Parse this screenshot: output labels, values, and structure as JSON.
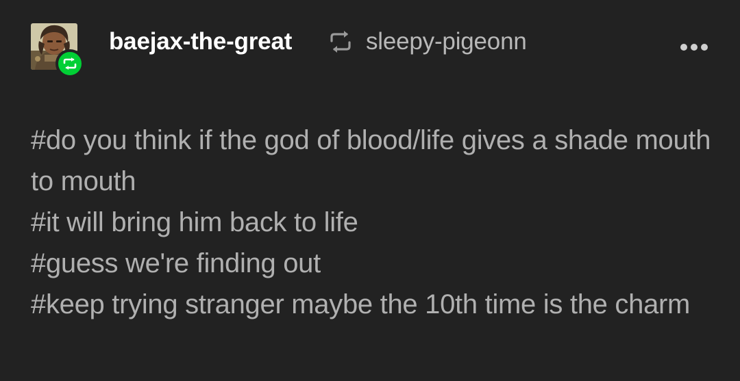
{
  "post": {
    "blog_name": "baejax-the-great",
    "reblogged_from": "sleepy-pigeonn",
    "icons": {
      "avatar": "avatar-image",
      "badge": "reblog-badge-icon",
      "reblog": "reblog-icon",
      "more": "more-options-icon"
    },
    "colors": {
      "background": "#222222",
      "blog_name": "#ffffff",
      "source_name": "#b8b8b8",
      "tags": "#b0b0b0",
      "badge": "#01cf35"
    },
    "tags": [
      "#do you think if the god of blood/life gives a shade mouth to mouth",
      "#it will bring him back to life",
      "#guess we're finding out",
      "#keep trying stranger maybe the 10th time is the charm"
    ]
  }
}
